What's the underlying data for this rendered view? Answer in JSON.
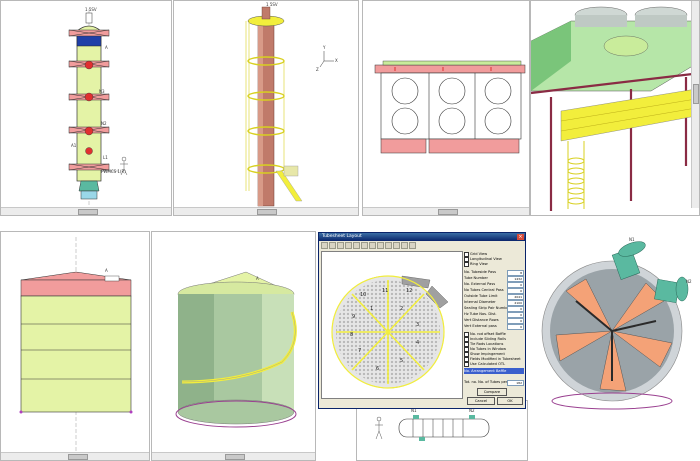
{
  "colors": {
    "pink": "#f19c9c",
    "lightgreen": "#e4f3a6",
    "green": "#c9ec9b",
    "maroon": "#8a2b44",
    "yellow": "#f2ee3c",
    "salmon": "#f4a277",
    "teal": "#5ab9a0",
    "blue": "#1f3fa8"
  },
  "panels": {
    "column_2d": {
      "labels": {
        "top": "1 5SV",
        "a": "A",
        "b": "B",
        "n3": "N3",
        "n2": "N2",
        "a1": "A1",
        "l1": "L1",
        "r": "R",
        "mark": "PWMCS 1(R)"
      }
    },
    "column_3d": {
      "labels": {
        "top": "1 5SV",
        "x": "X",
        "y": "Y",
        "z": "Z"
      }
    },
    "tank_3d": {
      "labels": {
        "a": "A"
      }
    },
    "nozzle_3d": {
      "labels": {
        "n1": "N1",
        "n2": "N2"
      }
    },
    "bottom_drawing": {
      "labels": {
        "n1": "N1",
        "n2": "N2"
      }
    }
  },
  "dialog": {
    "title": "Tubesheet Layout",
    "radios": {
      "a": "Grid View",
      "b": "Longitudinal View",
      "c": "Ring View"
    },
    "fields": [
      {
        "label": "No. Tubeside Pass",
        "value": "8"
      },
      {
        "label": "Tube Number",
        "value": "1432"
      },
      {
        "label": "No. External Pass",
        "value": "0"
      },
      {
        "label": "No Tubes Central Pass",
        "value": "0"
      },
      {
        "label": "Outside Tube Limit",
        "value": "2041"
      },
      {
        "label": "Internal Diameter",
        "value": "2100"
      },
      {
        "label": "Sealing Strip Pair Number",
        "value": "0"
      },
      {
        "label": "Hz Tube Nos. Dist.",
        "value": "0"
      },
      {
        "label": "Vert Distance Rows",
        "value": "0"
      },
      {
        "label": "Vert External pass",
        "value": "0"
      }
    ],
    "checks": [
      "No. rod offset Baffle",
      "Include Sliding Rails",
      "Tie Rods Locations",
      "No Tubes in Window",
      "Show Impingement",
      "Fields Modified in Tubesheet",
      "Use Calculated OTL"
    ],
    "highlight": "No. Arrangement Baffle",
    "footer_field": {
      "label": "Tot. no. No. of Tubes per Pass",
      "value": "182"
    },
    "buttons": {
      "compare": "Compare",
      "cancel": "Cancel",
      "ok": "OK"
    }
  },
  "dialog_canvas": {
    "sector_numbers": [
      "1",
      "2",
      "3",
      "4",
      "5",
      "6",
      "7",
      "8",
      "9",
      "10",
      "11",
      "12"
    ]
  }
}
